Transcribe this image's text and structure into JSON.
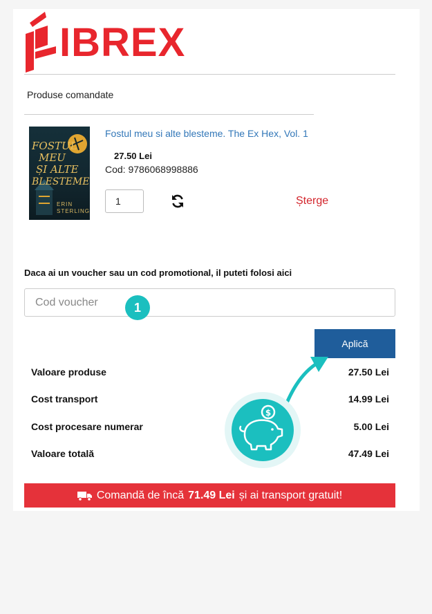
{
  "brand": {
    "name": "IBREX",
    "logo_color": "#e8262d"
  },
  "cart": {
    "section_title": "Produse comandate",
    "product": {
      "title": "Fostul meu si alte blesteme. The Ex Hex, Vol. 1",
      "price": "27.50 Lei",
      "code": "Cod: 9786068998886",
      "quantity": "1",
      "delete_label": "Șterge",
      "refresh_icon": "refresh-icon",
      "cover": {
        "title_line1": "FOSTUL",
        "title_line2": "MEU",
        "title_line3": "ȘI ALTE",
        "title_line4": "BLESTEME",
        "author": "ERIN STERLING"
      }
    }
  },
  "voucher": {
    "label": "Daca ai un voucher sau un cod promotional, il puteti folosi aici",
    "placeholder": "Cod voucher",
    "step_badge": "1",
    "apply_label": "Aplică"
  },
  "summary": {
    "rows": [
      {
        "label": "Valoare produse",
        "value": "27.50 Lei"
      },
      {
        "label": "Cost transport",
        "value": "14.99 Lei"
      },
      {
        "label": "Cost procesare numerar",
        "value": "5.00 Lei"
      },
      {
        "label": "Valoare totală",
        "value": "47.49 Lei"
      }
    ]
  },
  "banner": {
    "prefix": "Comandă de încă",
    "amount": "71.49 Lei",
    "suffix": "și ai transport gratuit!",
    "icon": "truck-icon",
    "color": "#e5323a"
  },
  "colors": {
    "accent_teal": "#1bbfbf",
    "button_blue": "#1f5d9b",
    "link_blue": "#3277b8",
    "delete_red": "#d3242b"
  }
}
